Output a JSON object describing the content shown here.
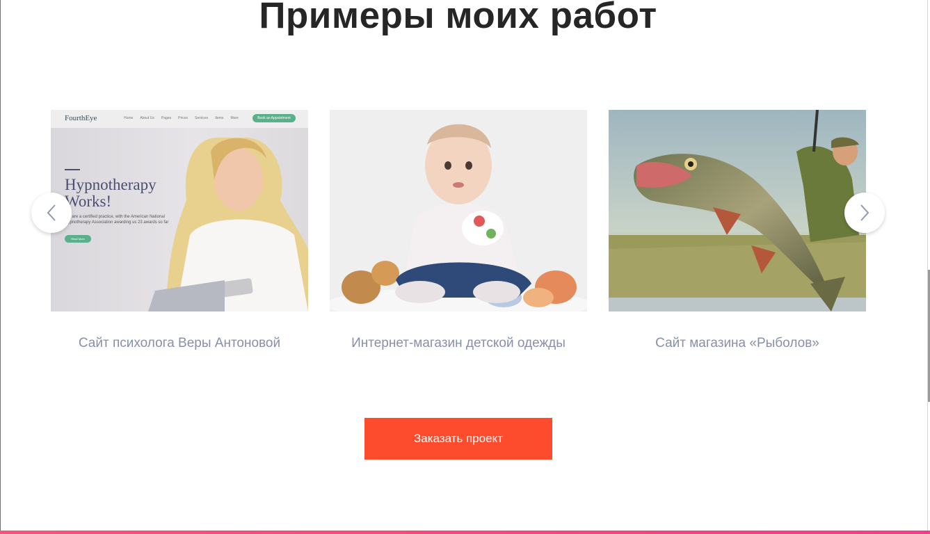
{
  "section": {
    "title": "Примеры моих работ"
  },
  "portfolio": [
    {
      "caption": "Сайт психолога Веры Антоновой",
      "preview": {
        "logo": "FourthEye",
        "nav": [
          "Home",
          "About Us",
          "Pages",
          "Prices",
          "Services",
          "Items",
          "More"
        ],
        "cta": "Book an Appointment",
        "headline_line1": "Hypnotherapy",
        "headline_line2": "Works!",
        "text": "We are a certified practice, with the American National Hypnotherapy Association awarding us 23 awards so far",
        "button": "Read More"
      }
    },
    {
      "caption": "Интернет-магазин детской одежды"
    },
    {
      "caption": "Сайт магазина «Рыболов»"
    }
  ],
  "carousel": {
    "prev_icon": "chevron-left-icon",
    "next_icon": "chevron-right-icon"
  },
  "cta": {
    "label": "Заказать проект",
    "color": "#fc4c2d"
  },
  "colors": {
    "title": "#262626",
    "caption": "#8690a8",
    "bottom_accent": "#f04787"
  }
}
